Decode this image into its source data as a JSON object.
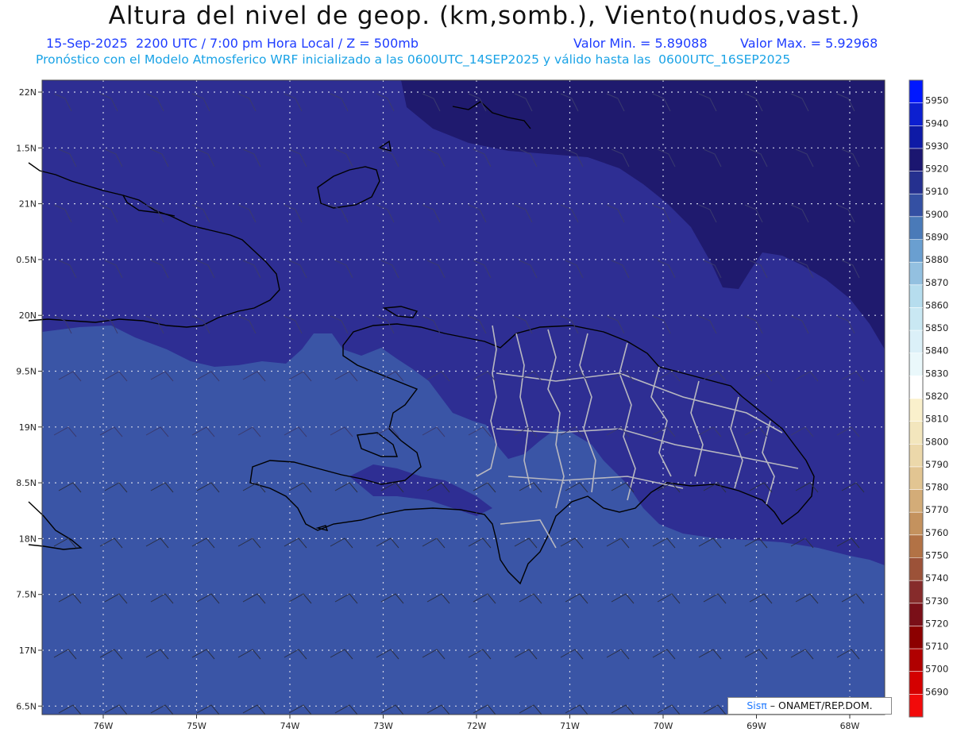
{
  "header": {
    "title": "Altura del nivel de geop. (km,somb.), Viento(nudos,vast.)",
    "datetime": "15-Sep-2025  2200 UTC / 7:00 pm Hora Local / Z = 500mb",
    "min_label": "Valor Min. = 5.89088",
    "max_label": "Valor Max. = 5.92968",
    "subtitle": "Pronóstico con el Modelo Atmosferico WRF inicializado a las 0600UTC_14SEP2025 y válido hasta las  0600UTC_16SEP2025"
  },
  "map": {
    "lon_ticks": [
      "76W",
      "75W",
      "74W",
      "73W",
      "72W",
      "71W",
      "70W",
      "69W",
      "68W"
    ],
    "lat_ticks": [
      "22N",
      "1.5N",
      "21N",
      "0.5N",
      "20N",
      "9.5N",
      "19N",
      "8.5N",
      "18N",
      "7.5N",
      "17N",
      "6.5N"
    ],
    "colors": {
      "zone_5900": "#3a55a6",
      "zone_5910": "#2e2e93",
      "zone_5920": "#1f1a6e",
      "grid": "#cfd3e6",
      "coastline": "#000000",
      "provinces": "#b8b8c0"
    }
  },
  "colorbar": {
    "labels": [
      "5950",
      "5940",
      "5930",
      "5920",
      "5910",
      "5900",
      "5890",
      "5880",
      "5870",
      "5860",
      "5850",
      "5840",
      "5830",
      "5820",
      "5810",
      "5800",
      "5790",
      "5780",
      "5770",
      "5760",
      "5750",
      "5740",
      "5730",
      "5720",
      "5710",
      "5700",
      "5690"
    ],
    "colors": [
      "#0018ff",
      "#0c1fd0",
      "#0e1aa6",
      "#1b1670",
      "#25308f",
      "#3450a3",
      "#4a7ab8",
      "#6a9fd0",
      "#93c0e0",
      "#b6ddee",
      "#c9e8f3",
      "#dbf0f8",
      "#eaf8fb",
      "#ffffff",
      "#faf0cc",
      "#f3e6bd",
      "#ecd8aa",
      "#e2c592",
      "#d3ac78",
      "#c4925e",
      "#b27245",
      "#9c5238",
      "#862b2b",
      "#7a0f18",
      "#8c0000",
      "#b00000",
      "#d40000",
      "#f20a0a"
    ]
  },
  "credit": {
    "brand": "Sisπ",
    "text": "– ONAMET/REP.DOM."
  }
}
